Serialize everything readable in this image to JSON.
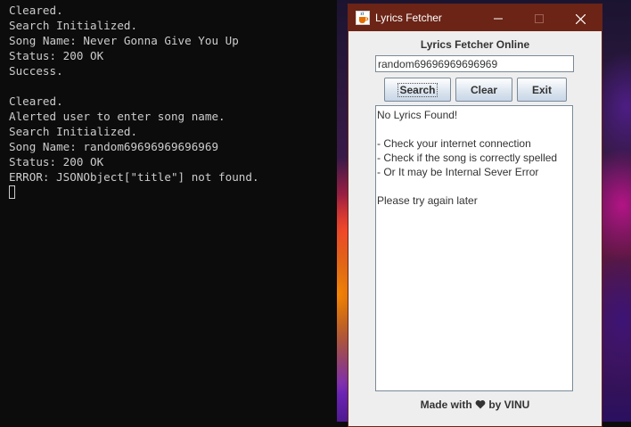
{
  "terminal": {
    "partial_top_line": "",
    "lines": [
      "Cleared.",
      "Search Initialized.",
      "Song Name: Never Gonna Give You Up",
      "Status: 200 OK",
      "Success.",
      "",
      "Cleared.",
      "Alerted user to enter song name.",
      "Search Initialized.",
      "Song Name: random69696969696969",
      "Status: 200 OK",
      "ERROR: JSONObject[\"title\"] not found."
    ]
  },
  "window": {
    "title": "Lyrics Fetcher",
    "heading": "Lyrics Fetcher Online",
    "song_input_value": "random69696969696969",
    "buttons": {
      "search": "Search",
      "clear": "Clear",
      "exit": "Exit"
    },
    "lyrics_lines": [
      "No Lyrics Found!",
      "",
      "- Check your internet connection",
      "- Check if the song is correctly spelled",
      "- Or It may be Internal Sever Error",
      "",
      "Please try again later"
    ],
    "footer_prefix": "Made with",
    "footer_suffix": "by VINU",
    "title_bar_color": "#6b2416"
  }
}
